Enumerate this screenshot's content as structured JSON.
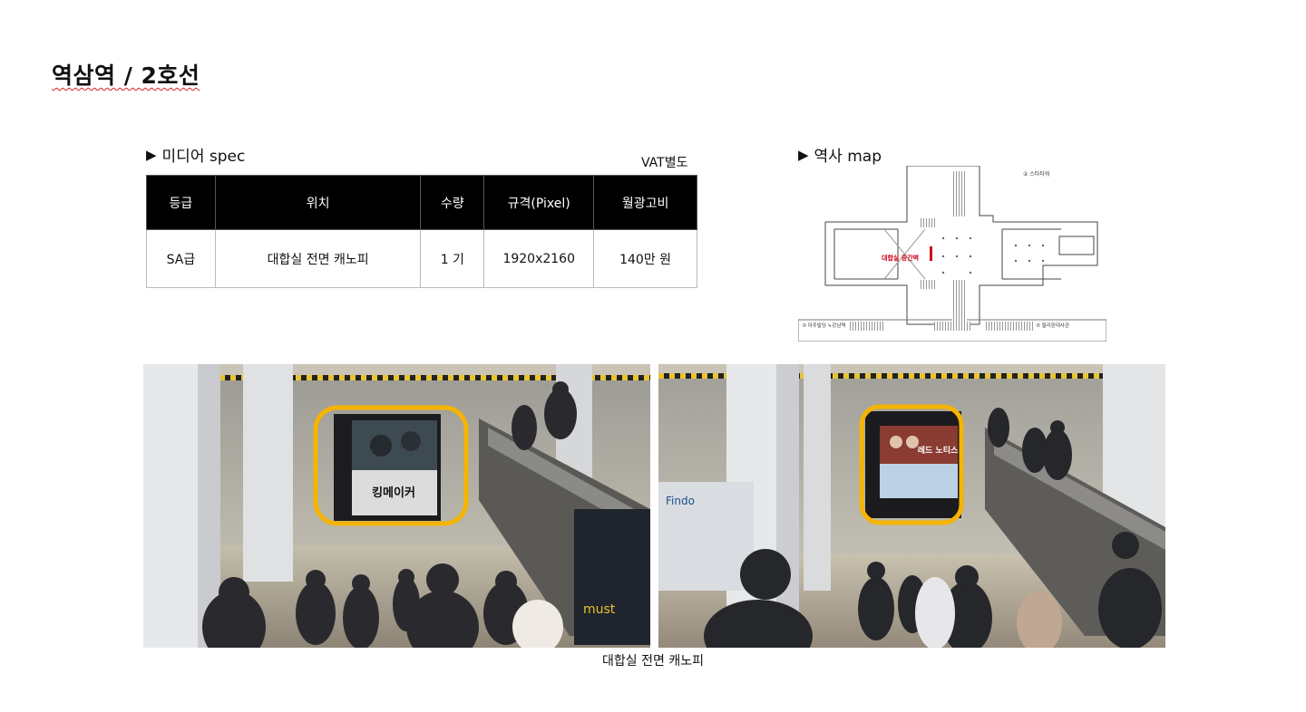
{
  "page": {
    "title": "역삼역 / 2호선"
  },
  "spec": {
    "heading": "미디어 spec",
    "note": "VAT별도",
    "columns": [
      "등급",
      "위치",
      "수량",
      "규격(Pixel)",
      "월광고비"
    ],
    "rows": [
      [
        "SA급",
        "대합실 전면 캐노피",
        "1 기",
        "1920x2160",
        "140만 원"
      ]
    ]
  },
  "map": {
    "heading": "역사 map",
    "highlight_label": "대합실 중간벽",
    "exit_labels": [
      "② 스타타워",
      "③ 아주빌딩 ↳강남역",
      "⑤ 필리핀대사관"
    ]
  },
  "photos": {
    "caption": "대합실 전면 캐노피",
    "left_poster_text": "킹메이커",
    "right_poster_text": "레드 노티스"
  },
  "colors": {
    "highlight_frame": "#f5b400",
    "header_bg": "#000000",
    "map_highlight": "#d0021b"
  }
}
